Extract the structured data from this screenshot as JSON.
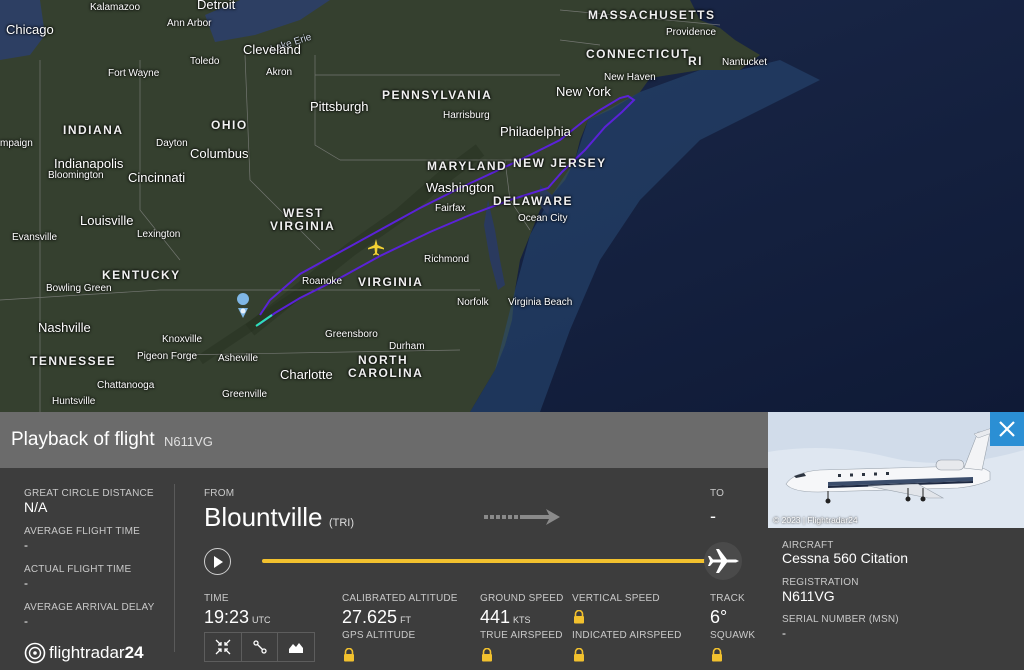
{
  "map": {
    "cities": [
      {
        "name": "Chicago",
        "size": "city"
      },
      {
        "name": "Detroit",
        "size": "city"
      },
      {
        "name": "Kalamazoo",
        "size": "town"
      },
      {
        "name": "Ann Arbor",
        "size": "town"
      },
      {
        "name": "Lake Erie",
        "size": "town"
      },
      {
        "name": "Cleveland",
        "size": "city"
      },
      {
        "name": "Akron",
        "size": "town"
      },
      {
        "name": "Fort Wayne",
        "size": "town"
      },
      {
        "name": "Toledo",
        "size": "town"
      },
      {
        "name": "Pittsburgh",
        "size": "city"
      },
      {
        "name": "Harrisburg",
        "size": "town"
      },
      {
        "name": "Philadelphia",
        "size": "city"
      },
      {
        "name": "New York",
        "size": "city"
      },
      {
        "name": "New Haven",
        "size": "town"
      },
      {
        "name": "Providence",
        "size": "town"
      },
      {
        "name": "Nantucket",
        "size": "town"
      },
      {
        "name": "Indianapolis",
        "size": "city"
      },
      {
        "name": "Bloomington",
        "size": "town"
      },
      {
        "name": "Dayton",
        "size": "town"
      },
      {
        "name": "Columbus",
        "size": "city"
      },
      {
        "name": "Cincinnati",
        "size": "city"
      },
      {
        "name": "Washington",
        "size": "city"
      },
      {
        "name": "Fairfax",
        "size": "town"
      },
      {
        "name": "Ocean City",
        "size": "town"
      },
      {
        "name": "Louisville",
        "size": "city"
      },
      {
        "name": "Lexington",
        "size": "town"
      },
      {
        "name": "Evansville",
        "size": "town"
      },
      {
        "name": "Richmond",
        "size": "town"
      },
      {
        "name": "Roanoke",
        "size": "town"
      },
      {
        "name": "Bowling Green",
        "size": "town"
      },
      {
        "name": "Norfolk",
        "size": "town"
      },
      {
        "name": "Virginia Beach",
        "size": "town"
      },
      {
        "name": "Nashville",
        "size": "city"
      },
      {
        "name": "Knoxville",
        "size": "town"
      },
      {
        "name": "Greensboro",
        "size": "town"
      },
      {
        "name": "Durham",
        "size": "town"
      },
      {
        "name": "Pigeon Forge",
        "size": "town"
      },
      {
        "name": "Asheville",
        "size": "town"
      },
      {
        "name": "Charlotte",
        "size": "city"
      },
      {
        "name": "Chattanooga",
        "size": "town"
      },
      {
        "name": "Huntsville",
        "size": "town"
      },
      {
        "name": "Greenville",
        "size": "town"
      },
      {
        "name": "mpaign",
        "size": "town"
      }
    ],
    "states": [
      "MASSACHUSETTS",
      "CONNECTICUT",
      "RI",
      "PENNSYLVANIA",
      "INDIANA",
      "OHIO",
      "MARYLAND",
      "NEW JERSEY",
      "DELAWARE",
      "WEST",
      "VIRGINIA",
      "VIRGINIA",
      "KENTUCKY",
      "TENNESSEE",
      "NORTH",
      "CAROLINA"
    ],
    "track_color": "#5a22d8"
  },
  "header": {
    "title": "Playback of flight",
    "registration": "N611VG"
  },
  "stats": {
    "gcd_label": "GREAT CIRCLE DISTANCE",
    "gcd_value": "N/A",
    "avg_time_label": "AVERAGE FLIGHT TIME",
    "avg_time_value": "-",
    "actual_time_label": "ACTUAL FLIGHT TIME",
    "actual_time_value": "-",
    "avg_delay_label": "AVERAGE ARRIVAL DELAY",
    "avg_delay_value": "-"
  },
  "route": {
    "from_label": "FROM",
    "from_city": "Blountville",
    "from_code": "(TRI)",
    "to_label": "TO",
    "to_value": "-"
  },
  "playback": {
    "progress": 0.98
  },
  "telemetry": {
    "time_label": "TIME",
    "time_value": "19:23",
    "time_unit": "UTC",
    "cal_alt_label": "CALIBRATED ALTITUDE",
    "cal_alt_value": "27.625",
    "cal_alt_unit": "FT",
    "gps_alt_label": "GPS ALTITUDE",
    "ground_speed_label": "GROUND SPEED",
    "ground_speed_value": "441",
    "ground_speed_unit": "KTS",
    "true_airspeed_label": "TRUE AIRSPEED",
    "vertical_speed_label": "VERTICAL SPEED",
    "indicated_airspeed_label": "INDICATED AIRSPEED",
    "track_label": "TRACK",
    "track_value": "6°",
    "squawk_label": "SQUAWK"
  },
  "aircraft": {
    "photo_credit": "© 2023 | Flightradar24",
    "aircraft_label": "AIRCRAFT",
    "aircraft_value": "Cessna 560 Citation",
    "registration_label": "REGISTRATION",
    "registration_value": "N611VG",
    "serial_label": "SERIAL NUMBER (MSN)",
    "serial_value": "-"
  },
  "logo": {
    "text_a": "flightradar",
    "text_b": "24"
  }
}
